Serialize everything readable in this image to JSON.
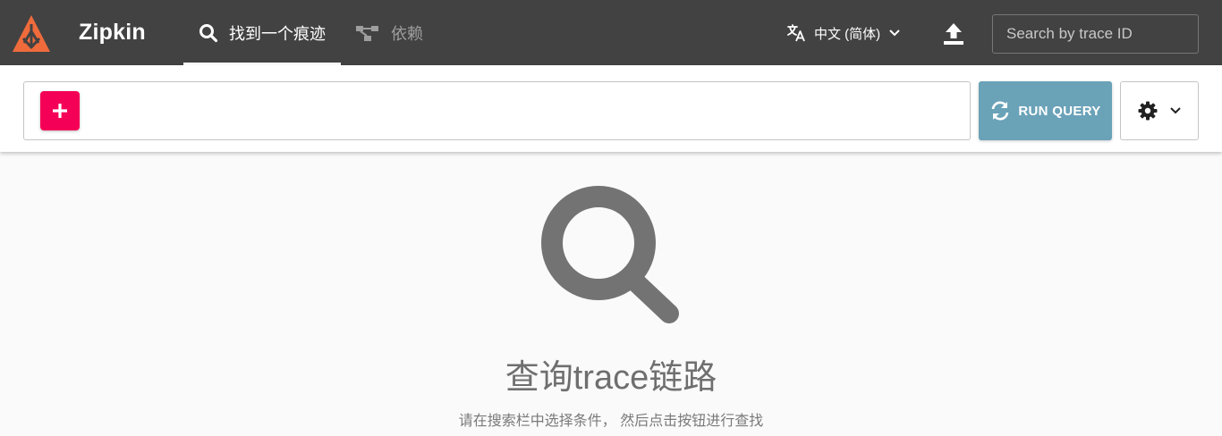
{
  "header": {
    "brand": "Zipkin",
    "tabs": [
      {
        "label": "找到一个痕迹",
        "icon": "search-icon",
        "active": true
      },
      {
        "label": "依赖",
        "icon": "dependency-icon",
        "active": false
      }
    ],
    "language": {
      "label": "中文 (简体)",
      "icon": "translate-icon"
    },
    "upload_icon": "upload-icon",
    "trace_search": {
      "placeholder": "Search by trace ID",
      "value": ""
    }
  },
  "query": {
    "add_icon": "plus-icon",
    "run_button_label": "RUN QUERY",
    "run_icon": "refresh-icon",
    "settings_icon": "gear-icon"
  },
  "empty_state": {
    "title": "查询trace链路",
    "subtitle": "请在搜索栏中选择条件， 然后点击按钮进行查找",
    "icon": "search-icon"
  },
  "colors": {
    "header_bg": "#424242",
    "logo": "#ef6b3c",
    "add_button": "#f50057",
    "run_button": "#6aa2b8",
    "page_bg": "#fafafa"
  }
}
